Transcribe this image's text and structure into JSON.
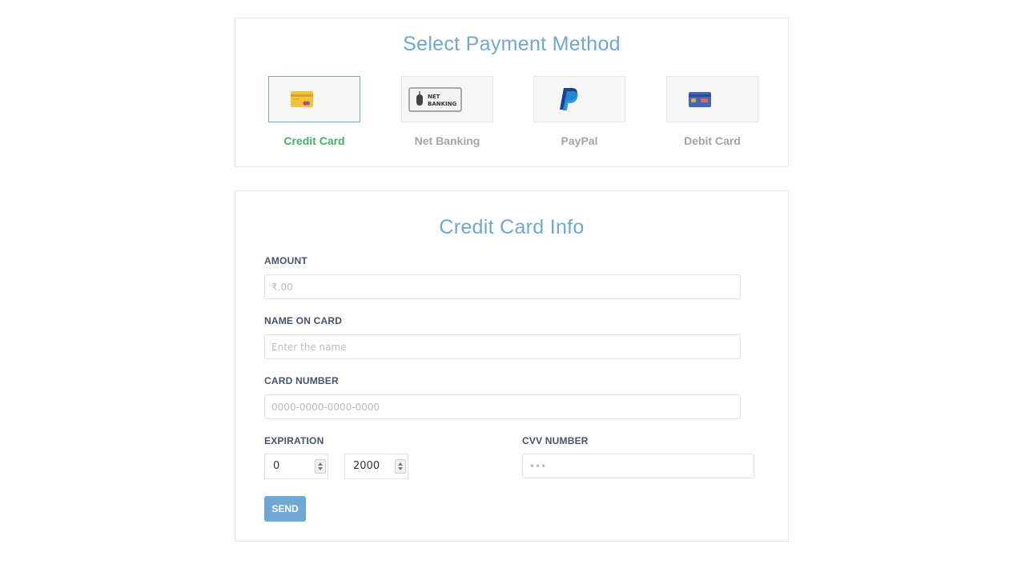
{
  "payment": {
    "title": "Select Payment Method",
    "methods": [
      {
        "label": "Credit Card",
        "icon": "credit-card-icon",
        "selected": true
      },
      {
        "label": "Net Banking",
        "icon": "net-banking-icon",
        "icon_text_1": "NET",
        "icon_text_2": "BANKING"
      },
      {
        "label": "PayPal",
        "icon": "paypal-icon"
      },
      {
        "label": "Debit Card",
        "icon": "debit-card-icon"
      }
    ]
  },
  "form": {
    "title": "Credit Card Info",
    "amount_label": "AMOUNT",
    "amount_placeholder": "₹.00",
    "name_label": "NAME ON CARD",
    "name_placeholder": "Enter the name",
    "card_label": "CARD NUMBER",
    "card_placeholder": "0000-0000-0000-0000",
    "expiration_label": "EXPIRATION",
    "exp_month": "0",
    "exp_year": "2000",
    "cvv_label": "CVV NUMBER",
    "cvv_placeholder": "•••",
    "send_label": "SEND"
  },
  "colors": {
    "accent": "#6fa8d3",
    "selected_label": "#44b265",
    "muted_label": "#a5a5a5"
  }
}
